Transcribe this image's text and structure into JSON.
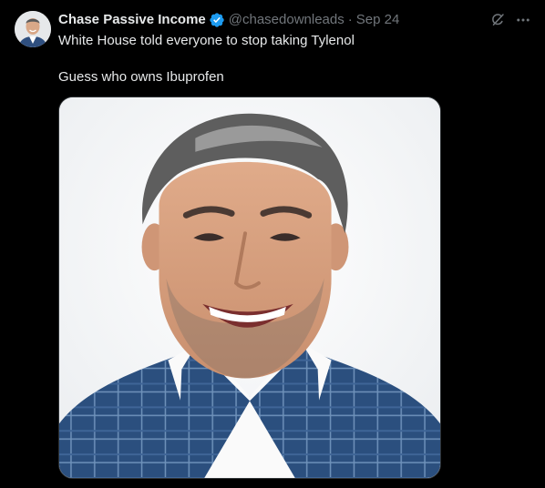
{
  "tweet": {
    "author": {
      "display_name": "Chase Passive Income",
      "handle": "@chasedownleads",
      "verified": true,
      "avatar": "profile-photo"
    },
    "separator": "·",
    "date": "Sep 24",
    "text_line1": "White House told everyone to stop taking Tylenol",
    "text_line2": "Guess who owns Ibuprofen",
    "media": {
      "kind": "photo",
      "subject": "portrait of smiling man in blue checkered blazer"
    },
    "actions": {
      "grok_icon": "grok-icon",
      "more_icon": "more-icon"
    }
  },
  "colors": {
    "background": "#000000",
    "primary_text": "#e7e9ea",
    "secondary_text": "#71767b",
    "verified_blue": "#1d9bf0"
  }
}
